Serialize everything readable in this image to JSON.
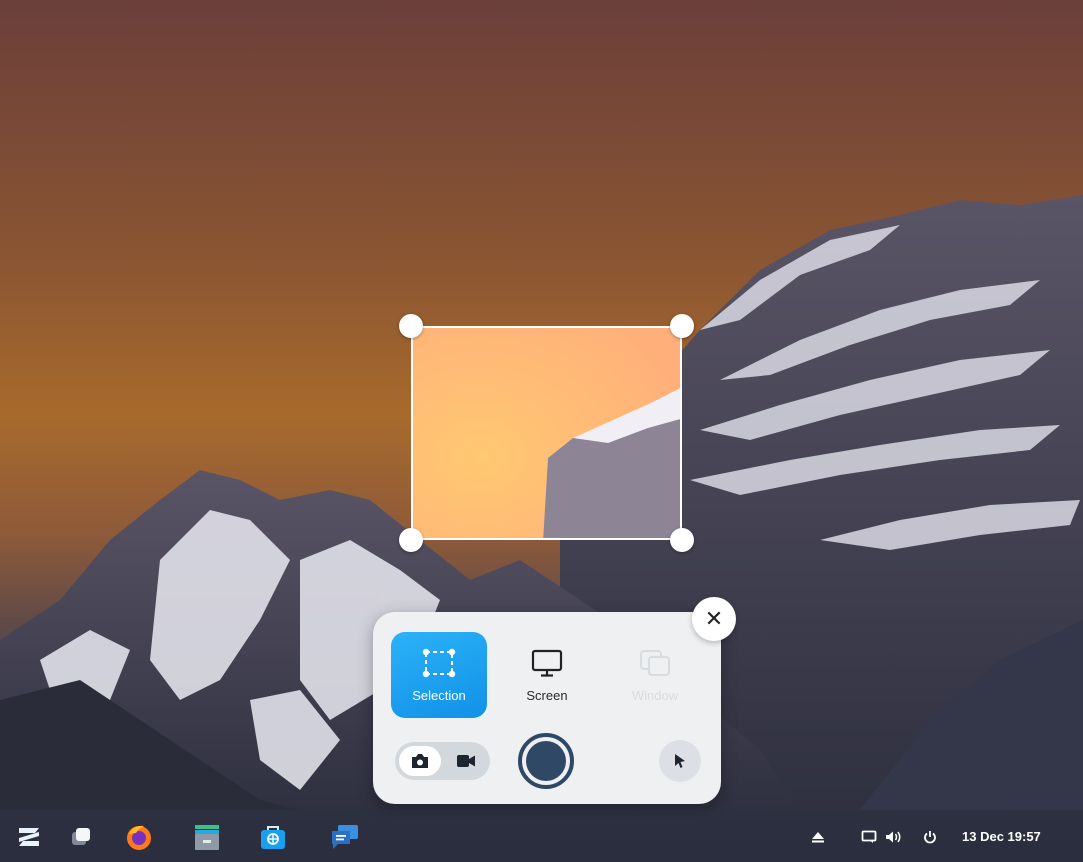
{
  "capture": {
    "modes": [
      {
        "label": "Selection",
        "icon": "selection-icon",
        "active": true
      },
      {
        "label": "Screen",
        "icon": "monitor-icon",
        "active": false
      },
      {
        "label": "Window",
        "icon": "window-icon",
        "active": false
      }
    ],
    "capture_type_icons": [
      "camera-icon",
      "video-camera-icon"
    ],
    "active_capture_type": "camera-icon",
    "shutter_icon": "record-button",
    "pointer_icon": "cursor-icon",
    "close_icon": "close-icon",
    "close_glyph": "✕"
  },
  "taskbar": {
    "apps": [
      "zorin-menu-icon",
      "workspaces-icon",
      "firefox-icon",
      "files-icon",
      "software-store-icon",
      "chat-icon"
    ],
    "tray": [
      "eject-icon",
      "display-icon",
      "volume-icon",
      "power-icon"
    ],
    "clock": "13 Dec  19:57"
  },
  "colors": {
    "accent": "#1a9ff0",
    "shutter": "#2f4866",
    "panel": "#eef0f2"
  }
}
